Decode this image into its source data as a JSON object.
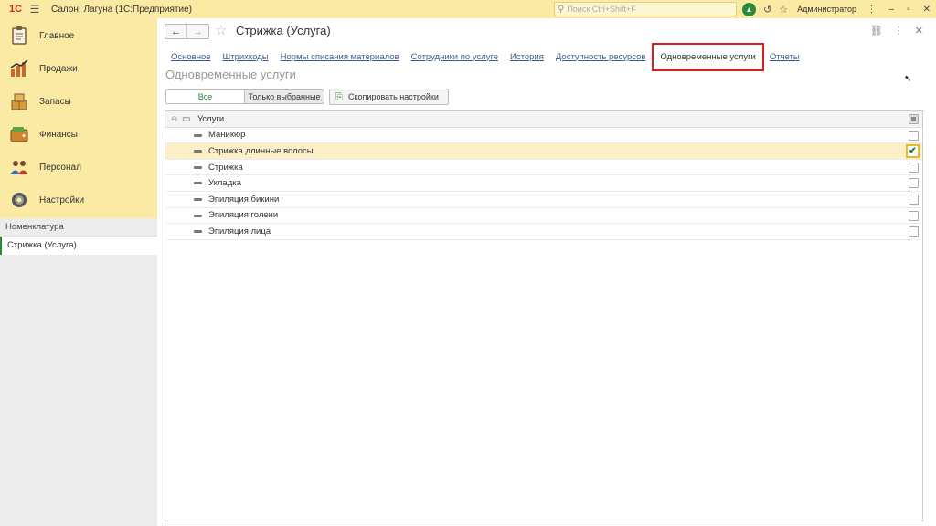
{
  "topbar": {
    "logo": "1С",
    "title": "Салон: Лагуна  (1С:Предприятие)",
    "search_placeholder": "Поиск Ctrl+Shift+F",
    "user": "Администратор",
    "accent": "#fbeaa3"
  },
  "sidebar": {
    "sections": [
      {
        "label": "Главное",
        "icon": "clipboard-icon"
      },
      {
        "label": "Продажи",
        "icon": "chart-icon"
      },
      {
        "label": "Запасы",
        "icon": "boxes-icon"
      },
      {
        "label": "Финансы",
        "icon": "wallet-icon"
      },
      {
        "label": "Персонал",
        "icon": "people-icon"
      },
      {
        "label": "Настройки",
        "icon": "gear-icon"
      }
    ],
    "group": "Номенклатура",
    "open_item": "Стрижка (Услуга)"
  },
  "form": {
    "title": "Стрижка (Услуга)",
    "tabs": [
      {
        "label": "Основное",
        "active": false
      },
      {
        "label": "Штрихкоды",
        "active": false
      },
      {
        "label": "Нормы списания материалов",
        "active": false
      },
      {
        "label": "Сотрудники по услуге",
        "active": false
      },
      {
        "label": "История",
        "active": false
      },
      {
        "label": "Доступность ресурсов",
        "active": false
      },
      {
        "label": "Одновременные услуги",
        "active": true
      },
      {
        "label": "Отчеты",
        "active": false
      }
    ],
    "subtitle": "Одновременные услуги",
    "filter_all": "Все",
    "filter_selected": "Только выбранные",
    "copy_button": "Скопировать настройки",
    "table": {
      "group": "Услуги",
      "rows": [
        {
          "name": "Маникюр",
          "checked": false
        },
        {
          "name": "Стрижка длинные волосы",
          "checked": true
        },
        {
          "name": "Стрижка",
          "checked": false
        },
        {
          "name": "Укладка",
          "checked": false
        },
        {
          "name": "Эпиляция бикини",
          "checked": false
        },
        {
          "name": "Эпиляция голени",
          "checked": false
        },
        {
          "name": "Эпиляция лица",
          "checked": false
        }
      ]
    }
  }
}
